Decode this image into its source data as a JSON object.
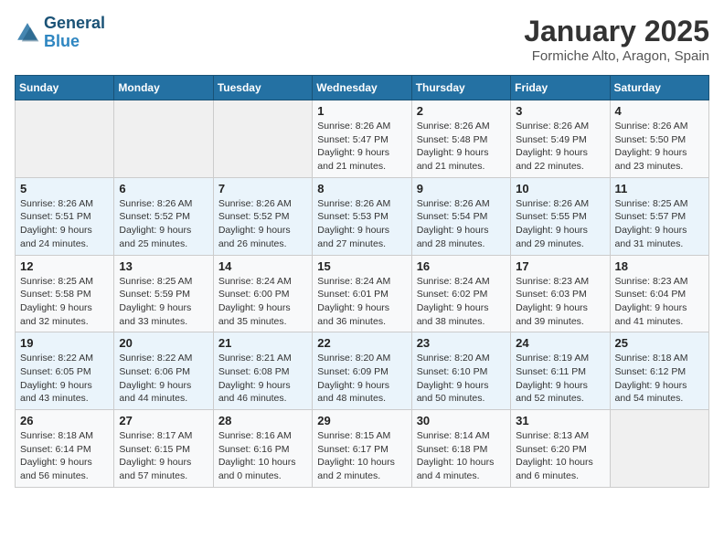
{
  "logo": {
    "line1": "General",
    "line2": "Blue"
  },
  "title": "January 2025",
  "location": "Formiche Alto, Aragon, Spain",
  "days_of_week": [
    "Sunday",
    "Monday",
    "Tuesday",
    "Wednesday",
    "Thursday",
    "Friday",
    "Saturday"
  ],
  "weeks": [
    [
      {
        "day": "",
        "sunrise": "",
        "sunset": "",
        "daylight": ""
      },
      {
        "day": "",
        "sunrise": "",
        "sunset": "",
        "daylight": ""
      },
      {
        "day": "",
        "sunrise": "",
        "sunset": "",
        "daylight": ""
      },
      {
        "day": "1",
        "sunrise": "Sunrise: 8:26 AM",
        "sunset": "Sunset: 5:47 PM",
        "daylight": "Daylight: 9 hours and 21 minutes."
      },
      {
        "day": "2",
        "sunrise": "Sunrise: 8:26 AM",
        "sunset": "Sunset: 5:48 PM",
        "daylight": "Daylight: 9 hours and 21 minutes."
      },
      {
        "day": "3",
        "sunrise": "Sunrise: 8:26 AM",
        "sunset": "Sunset: 5:49 PM",
        "daylight": "Daylight: 9 hours and 22 minutes."
      },
      {
        "day": "4",
        "sunrise": "Sunrise: 8:26 AM",
        "sunset": "Sunset: 5:50 PM",
        "daylight": "Daylight: 9 hours and 23 minutes."
      }
    ],
    [
      {
        "day": "5",
        "sunrise": "Sunrise: 8:26 AM",
        "sunset": "Sunset: 5:51 PM",
        "daylight": "Daylight: 9 hours and 24 minutes."
      },
      {
        "day": "6",
        "sunrise": "Sunrise: 8:26 AM",
        "sunset": "Sunset: 5:52 PM",
        "daylight": "Daylight: 9 hours and 25 minutes."
      },
      {
        "day": "7",
        "sunrise": "Sunrise: 8:26 AM",
        "sunset": "Sunset: 5:52 PM",
        "daylight": "Daylight: 9 hours and 26 minutes."
      },
      {
        "day": "8",
        "sunrise": "Sunrise: 8:26 AM",
        "sunset": "Sunset: 5:53 PM",
        "daylight": "Daylight: 9 hours and 27 minutes."
      },
      {
        "day": "9",
        "sunrise": "Sunrise: 8:26 AM",
        "sunset": "Sunset: 5:54 PM",
        "daylight": "Daylight: 9 hours and 28 minutes."
      },
      {
        "day": "10",
        "sunrise": "Sunrise: 8:26 AM",
        "sunset": "Sunset: 5:55 PM",
        "daylight": "Daylight: 9 hours and 29 minutes."
      },
      {
        "day": "11",
        "sunrise": "Sunrise: 8:25 AM",
        "sunset": "Sunset: 5:57 PM",
        "daylight": "Daylight: 9 hours and 31 minutes."
      }
    ],
    [
      {
        "day": "12",
        "sunrise": "Sunrise: 8:25 AM",
        "sunset": "Sunset: 5:58 PM",
        "daylight": "Daylight: 9 hours and 32 minutes."
      },
      {
        "day": "13",
        "sunrise": "Sunrise: 8:25 AM",
        "sunset": "Sunset: 5:59 PM",
        "daylight": "Daylight: 9 hours and 33 minutes."
      },
      {
        "day": "14",
        "sunrise": "Sunrise: 8:24 AM",
        "sunset": "Sunset: 6:00 PM",
        "daylight": "Daylight: 9 hours and 35 minutes."
      },
      {
        "day": "15",
        "sunrise": "Sunrise: 8:24 AM",
        "sunset": "Sunset: 6:01 PM",
        "daylight": "Daylight: 9 hours and 36 minutes."
      },
      {
        "day": "16",
        "sunrise": "Sunrise: 8:24 AM",
        "sunset": "Sunset: 6:02 PM",
        "daylight": "Daylight: 9 hours and 38 minutes."
      },
      {
        "day": "17",
        "sunrise": "Sunrise: 8:23 AM",
        "sunset": "Sunset: 6:03 PM",
        "daylight": "Daylight: 9 hours and 39 minutes."
      },
      {
        "day": "18",
        "sunrise": "Sunrise: 8:23 AM",
        "sunset": "Sunset: 6:04 PM",
        "daylight": "Daylight: 9 hours and 41 minutes."
      }
    ],
    [
      {
        "day": "19",
        "sunrise": "Sunrise: 8:22 AM",
        "sunset": "Sunset: 6:05 PM",
        "daylight": "Daylight: 9 hours and 43 minutes."
      },
      {
        "day": "20",
        "sunrise": "Sunrise: 8:22 AM",
        "sunset": "Sunset: 6:06 PM",
        "daylight": "Daylight: 9 hours and 44 minutes."
      },
      {
        "day": "21",
        "sunrise": "Sunrise: 8:21 AM",
        "sunset": "Sunset: 6:08 PM",
        "daylight": "Daylight: 9 hours and 46 minutes."
      },
      {
        "day": "22",
        "sunrise": "Sunrise: 8:20 AM",
        "sunset": "Sunset: 6:09 PM",
        "daylight": "Daylight: 9 hours and 48 minutes."
      },
      {
        "day": "23",
        "sunrise": "Sunrise: 8:20 AM",
        "sunset": "Sunset: 6:10 PM",
        "daylight": "Daylight: 9 hours and 50 minutes."
      },
      {
        "day": "24",
        "sunrise": "Sunrise: 8:19 AM",
        "sunset": "Sunset: 6:11 PM",
        "daylight": "Daylight: 9 hours and 52 minutes."
      },
      {
        "day": "25",
        "sunrise": "Sunrise: 8:18 AM",
        "sunset": "Sunset: 6:12 PM",
        "daylight": "Daylight: 9 hours and 54 minutes."
      }
    ],
    [
      {
        "day": "26",
        "sunrise": "Sunrise: 8:18 AM",
        "sunset": "Sunset: 6:14 PM",
        "daylight": "Daylight: 9 hours and 56 minutes."
      },
      {
        "day": "27",
        "sunrise": "Sunrise: 8:17 AM",
        "sunset": "Sunset: 6:15 PM",
        "daylight": "Daylight: 9 hours and 57 minutes."
      },
      {
        "day": "28",
        "sunrise": "Sunrise: 8:16 AM",
        "sunset": "Sunset: 6:16 PM",
        "daylight": "Daylight: 10 hours and 0 minutes."
      },
      {
        "day": "29",
        "sunrise": "Sunrise: 8:15 AM",
        "sunset": "Sunset: 6:17 PM",
        "daylight": "Daylight: 10 hours and 2 minutes."
      },
      {
        "day": "30",
        "sunrise": "Sunrise: 8:14 AM",
        "sunset": "Sunset: 6:18 PM",
        "daylight": "Daylight: 10 hours and 4 minutes."
      },
      {
        "day": "31",
        "sunrise": "Sunrise: 8:13 AM",
        "sunset": "Sunset: 6:20 PM",
        "daylight": "Daylight: 10 hours and 6 minutes."
      },
      {
        "day": "",
        "sunrise": "",
        "sunset": "",
        "daylight": ""
      }
    ]
  ]
}
